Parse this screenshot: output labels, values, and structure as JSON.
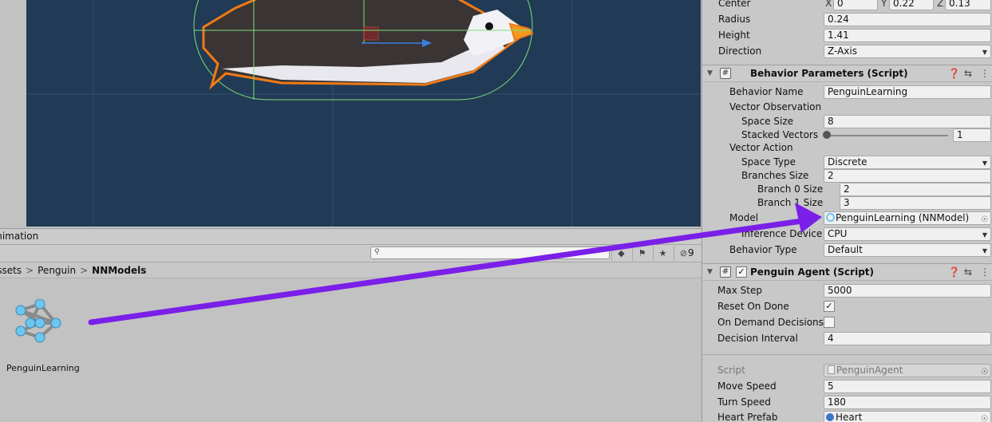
{
  "project": {
    "tab_label": "Animation",
    "search": {
      "value": "",
      "placeholder": ""
    },
    "hidden_count": "9",
    "breadcrumb": [
      "Assets",
      "Penguin",
      "NNModels"
    ],
    "asset": {
      "name": "PenguinLearning"
    }
  },
  "inspector": {
    "capsule": {
      "center": {
        "label": "Center",
        "x_label": "X",
        "x": "0",
        "y_label": "Y",
        "y": "0.22",
        "z_label": "Z",
        "z": "0.13"
      },
      "radius": {
        "label": "Radius",
        "value": "0.24"
      },
      "height": {
        "label": "Height",
        "value": "1.41"
      },
      "direction": {
        "label": "Direction",
        "value": "Z-Axis"
      }
    },
    "behavior": {
      "title": "Behavior Parameters (Script)",
      "behavior_name": {
        "label": "Behavior Name",
        "value": "PenguinLearning"
      },
      "vector_observation": "Vector Observation",
      "space_size": {
        "label": "Space Size",
        "value": "8"
      },
      "stacked_vectors": {
        "label": "Stacked Vectors",
        "value": "1",
        "level": 0
      },
      "vector_action": "Vector Action",
      "space_type": {
        "label": "Space Type",
        "value": "Discrete"
      },
      "branches_size": {
        "label": "Branches Size",
        "value": "2"
      },
      "branch0": {
        "label": "Branch 0 Size",
        "value": "2"
      },
      "branch1": {
        "label": "Branch 1 Size",
        "value": "3"
      },
      "model": {
        "label": "Model",
        "value": "PenguinLearning (NNModel)"
      },
      "inference_device": {
        "label": "Inference Device",
        "value": "CPU"
      },
      "behavior_type": {
        "label": "Behavior Type",
        "value": "Default"
      }
    },
    "agent": {
      "title": "Penguin Agent (Script)",
      "max_step": {
        "label": "Max Step",
        "value": "5000"
      },
      "reset_on_done": {
        "label": "Reset On Done",
        "checked": true
      },
      "on_demand": {
        "label": "On Demand Decisions",
        "checked": false
      },
      "decision_interval": {
        "label": "Decision Interval",
        "value": "4"
      },
      "script": {
        "label": "Script",
        "value": "PenguinAgent"
      },
      "move_speed": {
        "label": "Move Speed",
        "value": "5"
      },
      "turn_speed": {
        "label": "Turn Speed",
        "value": "180"
      },
      "heart_prefab": {
        "label": "Heart Prefab",
        "value": "Heart"
      }
    }
  },
  "colors": {
    "scene_bg": "#213a55",
    "selection_outline": "#f07a16",
    "annotation_arrow": "#7a1fe8",
    "model_node": "#6ec6ef"
  }
}
